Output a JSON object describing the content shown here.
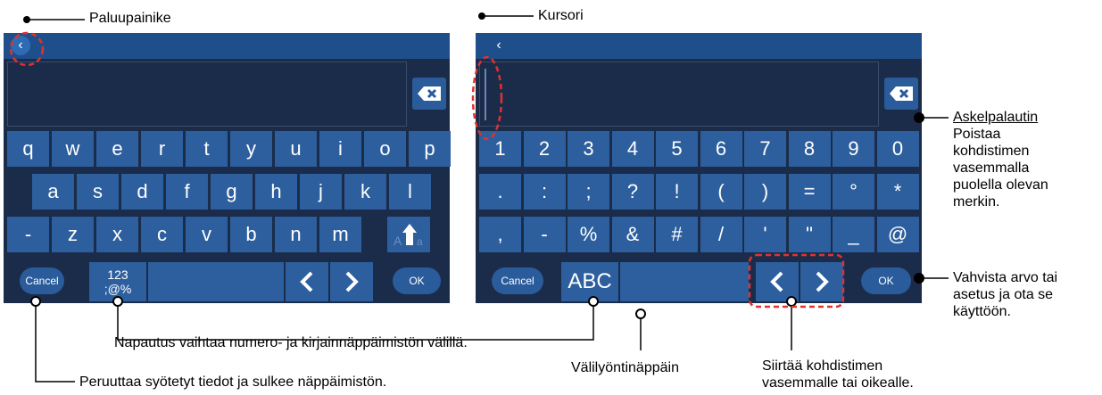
{
  "annotations": {
    "back": "Paluupainike",
    "cursor": "Kursori",
    "backspace_title": "Askelpalautin",
    "backspace_l1": "Poistaa",
    "backspace_l2": "kohdistimen",
    "backspace_l3": "vasemmalla",
    "backspace_l4": "puolella olevan",
    "backspace_l5": "merkin.",
    "confirm_l1": "Vahvista arvo tai",
    "confirm_l2": "asetus ja ota se",
    "confirm_l3": "käyttöön.",
    "toggle": "Napautus vaihtaa numero- ja kirjainnäppäimistön välillä.",
    "space": "Välilyöntinäppäin",
    "cancel": "Peruuttaa syötetyt tiedot ja sulkee näppäimistön.",
    "arrows_l1": "Siirtää kohdistimen",
    "arrows_l2": "vasemmalle tai oikealle."
  },
  "left": {
    "row1": [
      "q",
      "w",
      "e",
      "r",
      "t",
      "y",
      "u",
      "i",
      "o",
      "p"
    ],
    "row2": [
      "a",
      "s",
      "d",
      "f",
      "g",
      "h",
      "j",
      "k",
      "l"
    ],
    "row3": [
      "-",
      "z",
      "x",
      "c",
      "v",
      "b",
      "n",
      "m"
    ],
    "cancel": "Cancel",
    "mode_l1": "123",
    "mode_l2": ";@%",
    "ok": "OK"
  },
  "right": {
    "row1": [
      "1",
      "2",
      "3",
      "4",
      "5",
      "6",
      "7",
      "8",
      "9",
      "0"
    ],
    "row2": [
      ".",
      ":",
      ";",
      "?",
      "!",
      "(",
      ")",
      "=",
      "°",
      "*"
    ],
    "row3": [
      ",",
      "-",
      "%",
      "&",
      "#",
      "/",
      "'",
      "\"",
      "_",
      "@"
    ],
    "cancel": "Cancel",
    "mode": "ABC",
    "ok": "OK"
  },
  "colors": {
    "keyboard_bg": "#1b2c4a",
    "key": "#2d5f9e",
    "topbar": "#1f4f8b",
    "highlight": "#e0322e"
  }
}
